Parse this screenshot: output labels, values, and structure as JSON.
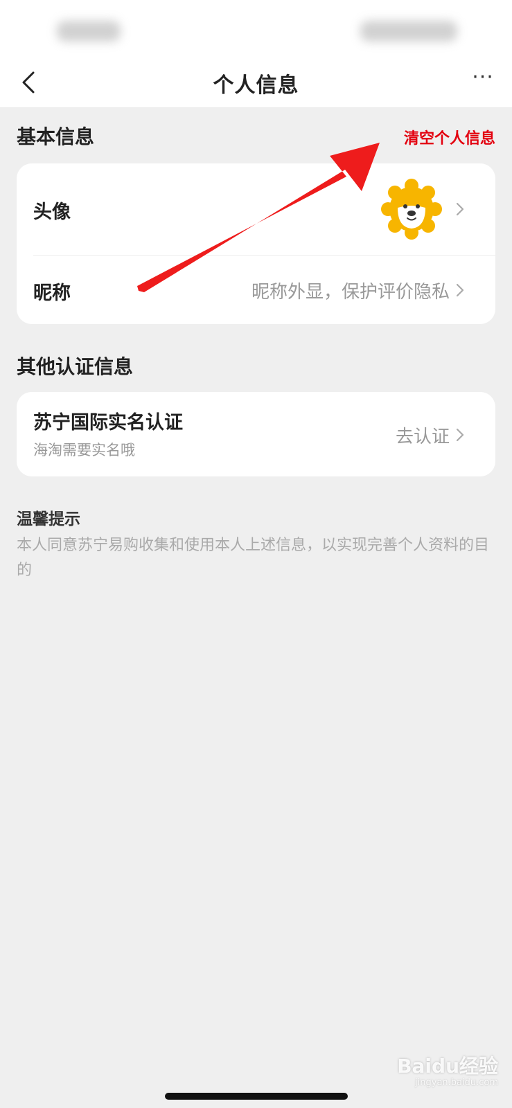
{
  "nav": {
    "title": "个人信息",
    "more": "···"
  },
  "basic_section": {
    "title": "基本信息",
    "clear_link": "清空个人信息",
    "avatar_label": "头像",
    "nickname_label": "昵称",
    "nickname_placeholder": "昵称外显，保护评价隐私"
  },
  "other_section": {
    "title": "其他认证信息",
    "cert_title": "苏宁国际实名认证",
    "cert_subtitle": "海淘需要实名哦",
    "cert_action": "去认证"
  },
  "tips": {
    "title": "温馨提示",
    "body": "本人同意苏宁易购收集和使用本人上述信息，以实现完善个人资料的目的"
  },
  "watermark": {
    "brand": "Baidu经验",
    "url": "jingyan.baidu.com"
  },
  "colors": {
    "accent": "#e3000f",
    "background": "#efefef",
    "card": "#ffffff",
    "avatar_yellow": "#f7b500",
    "arrow_red": "#ee1c1c"
  },
  "icons": {
    "back": "chevron-left-icon",
    "more": "more-dots-icon",
    "row_chevron": "chevron-right-icon",
    "avatar": "lion-avatar-icon"
  }
}
